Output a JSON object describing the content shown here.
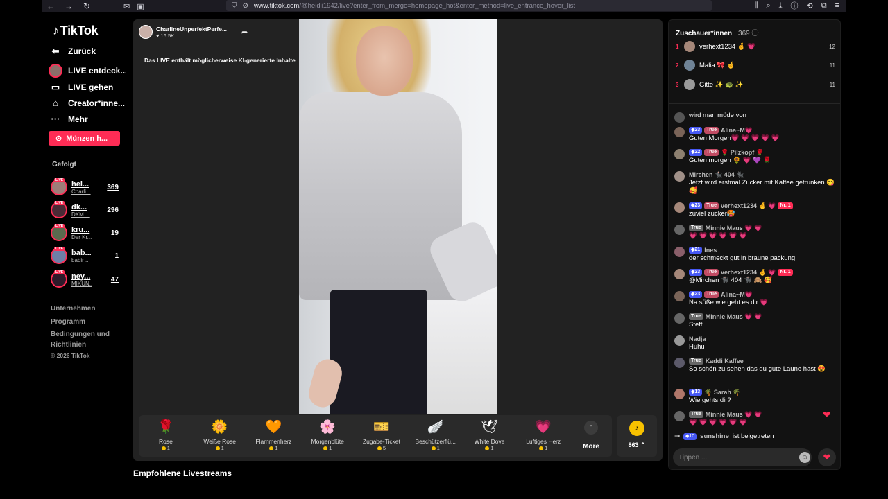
{
  "browser": {
    "url_domain": "www.tiktok.com",
    "url_path": "/@heidii1942/live?enter_from_merge=homepage_hot&enter_method=live_entrance_hover_list"
  },
  "sidebar": {
    "logo": "TikTok",
    "back": "Zurück",
    "nav": [
      {
        "label": "LIVE entdeck...",
        "icon": "live-avatar"
      },
      {
        "label": "LIVE gehen",
        "icon": "video-camera-icon"
      },
      {
        "label": "Creator*inne...",
        "icon": "house-icon"
      },
      {
        "label": "Mehr",
        "icon": "more-dots-icon"
      }
    ],
    "coins_button": "Münzen h...",
    "followed_title": "Gefolgt",
    "followed": [
      {
        "name": "hei...",
        "sub": "Charli...",
        "count": "369"
      },
      {
        "name": "dk...",
        "sub": "DKM ...",
        "count": "296"
      },
      {
        "name": "kru...",
        "sub": "Der Kr...",
        "count": "19"
      },
      {
        "name": "bab...",
        "sub": "babir ...",
        "count": "1"
      },
      {
        "name": "ney...",
        "sub": "MIKUN...",
        "count": "47"
      }
    ],
    "footer": [
      "Unternehmen",
      "Programm",
      "Bedingungen und Richtlinien"
    ],
    "copyright": "© 2026 TikTok"
  },
  "stage": {
    "host_name": "CharlineUnperfektPerfe...",
    "host_likes": "16.5K",
    "ai_notice": "Das LIVE enthält möglicherweise KI-generierte Inhalte",
    "gifts": [
      {
        "name": "Rose",
        "price": "1",
        "icon": "🌹"
      },
      {
        "name": "Weiße Rose",
        "price": "1",
        "icon": "🌼"
      },
      {
        "name": "Flammenherz",
        "price": "1",
        "icon": "🧡"
      },
      {
        "name": "Morgenblüte",
        "price": "1",
        "icon": "🌸"
      },
      {
        "name": "Zugabe-Ticket",
        "price": "5",
        "icon": "🎫"
      },
      {
        "name": "Beschützerflü...",
        "price": "1",
        "icon": "🪽"
      },
      {
        "name": "White Dove",
        "price": "1",
        "icon": "🕊"
      },
      {
        "name": "Luftiges Herz",
        "price": "1",
        "icon": "💗"
      }
    ],
    "more_label": "More",
    "wallet_balance": "863"
  },
  "recommended_title": "Empfohlene Livestreams",
  "chat": {
    "viewers_label": "Zuschauer*innen",
    "viewers_count": "369",
    "ranking": [
      {
        "rank": "1",
        "name": "verhext1234 🤞 💗",
        "score": "12"
      },
      {
        "rank": "2",
        "name": "Malia 🎀 🤞",
        "score": "11"
      },
      {
        "rank": "3",
        "name": "Gitte ✨ 🐢 ✨",
        "score": "11"
      }
    ],
    "messages": [
      {
        "level": "",
        "fan": "",
        "name": "",
        "text": "wird man müde von"
      },
      {
        "level": "23",
        "fan": "True",
        "name": "Alina~M💗",
        "text": "Guten Morgen💗 💗 💗 💗 💗"
      },
      {
        "level": "22",
        "fan": "True",
        "name": "🌹 Pilzkopf 🌹",
        "text": "Guten morgen 🌻 💗 💜 🌹"
      },
      {
        "level": "",
        "fan": "",
        "name": "Mirchen 🐈‍⬛ 404 🐈‍⬛",
        "text": "Jetzt wird erstmal Zucker mit Kaffee getrunken 😋 🥰"
      },
      {
        "level": "23",
        "fan": "True",
        "name": "verhext1234 🤞 💗",
        "rank": "Nr. 1",
        "text": "zuviel zucker🥵"
      },
      {
        "level": "",
        "fan": "True",
        "name": "Minnie Maus 💗 💗",
        "text": "💗 💗 💗 💗 💗 💗"
      },
      {
        "level": "21",
        "fan": "",
        "name": "Ines",
        "text": "der schmeckt gut in braune packung"
      },
      {
        "level": "23",
        "fan": "True",
        "name": "verhext1234 🤞 💗",
        "rank": "Nr. 1",
        "text": "@Mirchen 🐈‍⬛ 404 🐈‍⬛ 🙈 🥰"
      },
      {
        "level": "23",
        "fan": "True",
        "name": "Alina~M💗",
        "text": "Na süße wie geht es dir 💗"
      },
      {
        "level": "",
        "fan": "True",
        "name": "Minnie Maus 💗 💗",
        "text": "Steffi"
      },
      {
        "level": "",
        "fan": "",
        "name": "Nadja",
        "text": "Huhu"
      },
      {
        "level": "",
        "fan": "True",
        "name": "Kaddi Kaffee",
        "text": "So schön zu sehen das du gute Laune hast 😍"
      },
      {
        "level": "13",
        "fan": "",
        "name": "🌴 Sarah 🌴",
        "text": "Wie gehts dir?"
      },
      {
        "level": "",
        "fan": "True",
        "name": "Minnie Maus 💗 💗",
        "text": "💗 💗 💗 💗 💗 💗"
      }
    ],
    "joined": {
      "level": "10",
      "name": "sunshine",
      "text": "ist beigetreten"
    },
    "input_placeholder": "Tippen ..."
  },
  "colors": {
    "accent": "#fe2c55",
    "level_badge": "#4658f5",
    "coin": "#f7c100"
  }
}
